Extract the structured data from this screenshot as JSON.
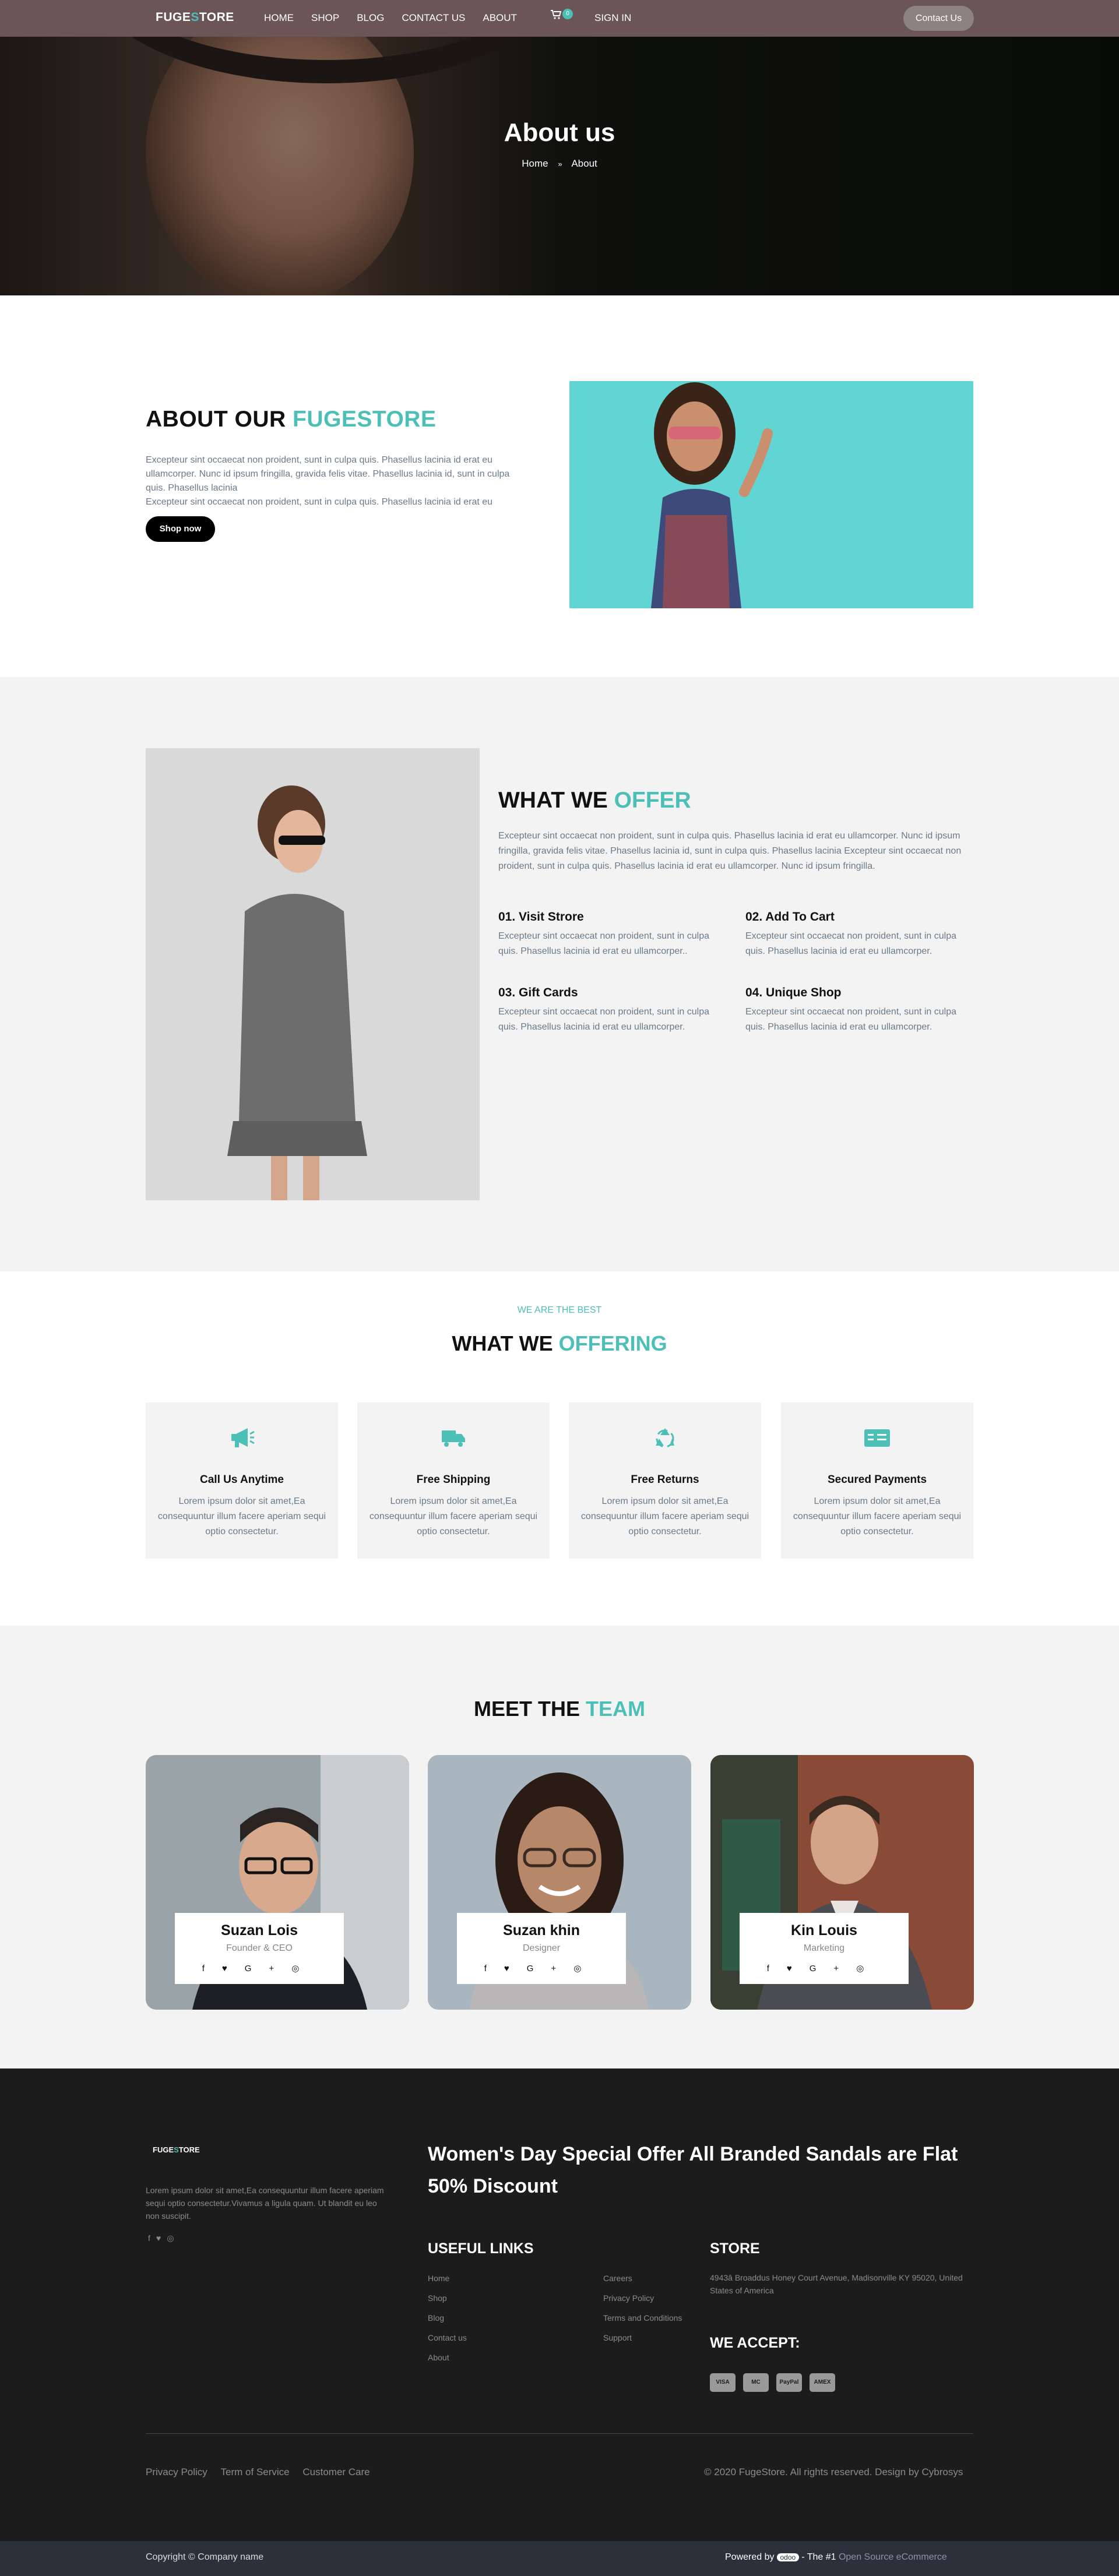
{
  "nav": {
    "logo_left": "FUGE",
    "logo_s": "S",
    "logo_right": "TORE",
    "menu": [
      "HOME",
      "SHOP",
      "BLOG",
      "CONTACT US",
      "ABOUT"
    ],
    "cart_count": "0",
    "sign_in": "SIGN IN",
    "contact_button": "Contact Us"
  },
  "hero": {
    "title": "About us",
    "breadcrumb_home": "Home",
    "breadcrumb_sep": "»",
    "breadcrumb_current": "About"
  },
  "about": {
    "title_plain": "ABOUT OUR ",
    "title_accent": "FUGESTORE",
    "text": "Excepteur sint occaecat non proident, sunt in culpa quis. Phasellus lacinia id erat eu ullamcorper. Nunc id ipsum fringilla, gravida felis vitae. Phasellus lacinia id, sunt in culpa quis. Phasellus lacinia",
    "text2": "Excepteur sint occaecat non proident, sunt in culpa quis. Phasellus lacinia id erat eu",
    "button": "Shop now"
  },
  "offer": {
    "title_plain": "WHAT WE ",
    "title_accent": "OFFER",
    "text": "Excepteur sint occaecat non proident, sunt in culpa quis. Phasellus lacinia id erat eu ullamcorper. Nunc id ipsum fringilla, gravida felis vitae. Phasellus lacinia id, sunt in culpa quis. Phasellus lacinia Excepteur sint occaecat non proident, sunt in culpa quis. Phasellus lacinia id erat eu ullamcorper. Nunc id ipsum fringilla.",
    "features": [
      {
        "title": "01. Visit Strore",
        "text": "Excepteur sint occaecat non proident, sunt in culpa quis. Phasellus lacinia id erat eu ullamcorper.."
      },
      {
        "title": "02. Add To Cart",
        "text": "Excepteur sint occaecat non proident, sunt in culpa quis. Phasellus lacinia id erat eu ullamcorper."
      },
      {
        "title": "03. Gift Cards",
        "text": "Excepteur sint occaecat non proident, sunt in culpa quis. Phasellus lacinia id erat eu ullamcorper."
      },
      {
        "title": "04. Unique Shop",
        "text": "Excepteur sint occaecat non proident, sunt in culpa quis. Phasellus lacinia id erat eu ullamcorper."
      }
    ]
  },
  "offering": {
    "kicker": "WE ARE THE BEST",
    "title_plain": "WHAT WE ",
    "title_accent": "OFFERING",
    "cards": [
      {
        "icon": "megaphone-icon",
        "title": "Call Us Anytime",
        "text": "Lorem ipsum dolor sit amet,Ea consequuntur illum facere aperiam sequi optio consectetur."
      },
      {
        "icon": "truck-icon",
        "title": "Free Shipping",
        "text": "Lorem ipsum dolor sit amet,Ea consequuntur illum facere aperiam sequi optio consectetur."
      },
      {
        "icon": "recycle-icon",
        "title": "Free Returns",
        "text": "Lorem ipsum dolor sit amet,Ea consequuntur illum facere aperiam sequi optio consectetur."
      },
      {
        "icon": "payment-card-icon",
        "title": "Secured Payments",
        "text": "Lorem ipsum dolor sit amet,Ea consequuntur illum facere aperiam sequi optio consectetur."
      }
    ]
  },
  "team": {
    "title_plain": "MEET THE ",
    "title_accent": "TEAM",
    "members": [
      {
        "name": "Suzan Lois",
        "role": "Founder & CEO"
      },
      {
        "name": "Suzan khin",
        "role": "Designer"
      },
      {
        "name": "Kin Louis",
        "role": "Marketing"
      }
    ],
    "social_icons": [
      "facebook-icon",
      "twitter-icon",
      "google-plus-icon",
      "instagram-icon"
    ]
  },
  "footer": {
    "logo_left": "FUGE",
    "logo_s": "S",
    "logo_right": "TORE",
    "about_text": "Lorem ipsum dolor sit amet,Ea consequuntur illum facere aperiam sequi optio consectetur.Vivamus a ligula quam. Ut blandit eu leo non suscipit.",
    "promo": "Women's Day Special Offer All Branded Sandals are Flat 50% Discount",
    "useful_links_title": "USEFUL LINKS",
    "links_col1": [
      "Home",
      "Shop",
      "Blog",
      "Contact us",
      "About"
    ],
    "links_col2": [
      "Careers",
      "Privacy Policy",
      "Terms and Conditions",
      "Support"
    ],
    "store_title": "STORE",
    "store_address": "4943â Broaddus Honey Court Avenue, Madisonville KY 95020, United States of America",
    "accept_title": "WE ACCEPT:",
    "payments": [
      "VISA",
      "MC",
      "PayPal",
      "AMEX"
    ],
    "bottom_links": [
      "Privacy Policy",
      "Term of Service",
      "Customer Care"
    ],
    "rights": "© 2020 FugeStore. All rights reserved. Design by Cybrosys",
    "copyright": "Copyright © Company name",
    "powered_by": "Powered by",
    "odoo": "odoo",
    "tagline_mid": "- The #1",
    "tagline_link": "Open Source eCommerce"
  },
  "colors": {
    "accent": "#4cbfb6",
    "nav": "#6b5557",
    "footer": "#1c1c1c",
    "subfooter": "#2b303a"
  }
}
